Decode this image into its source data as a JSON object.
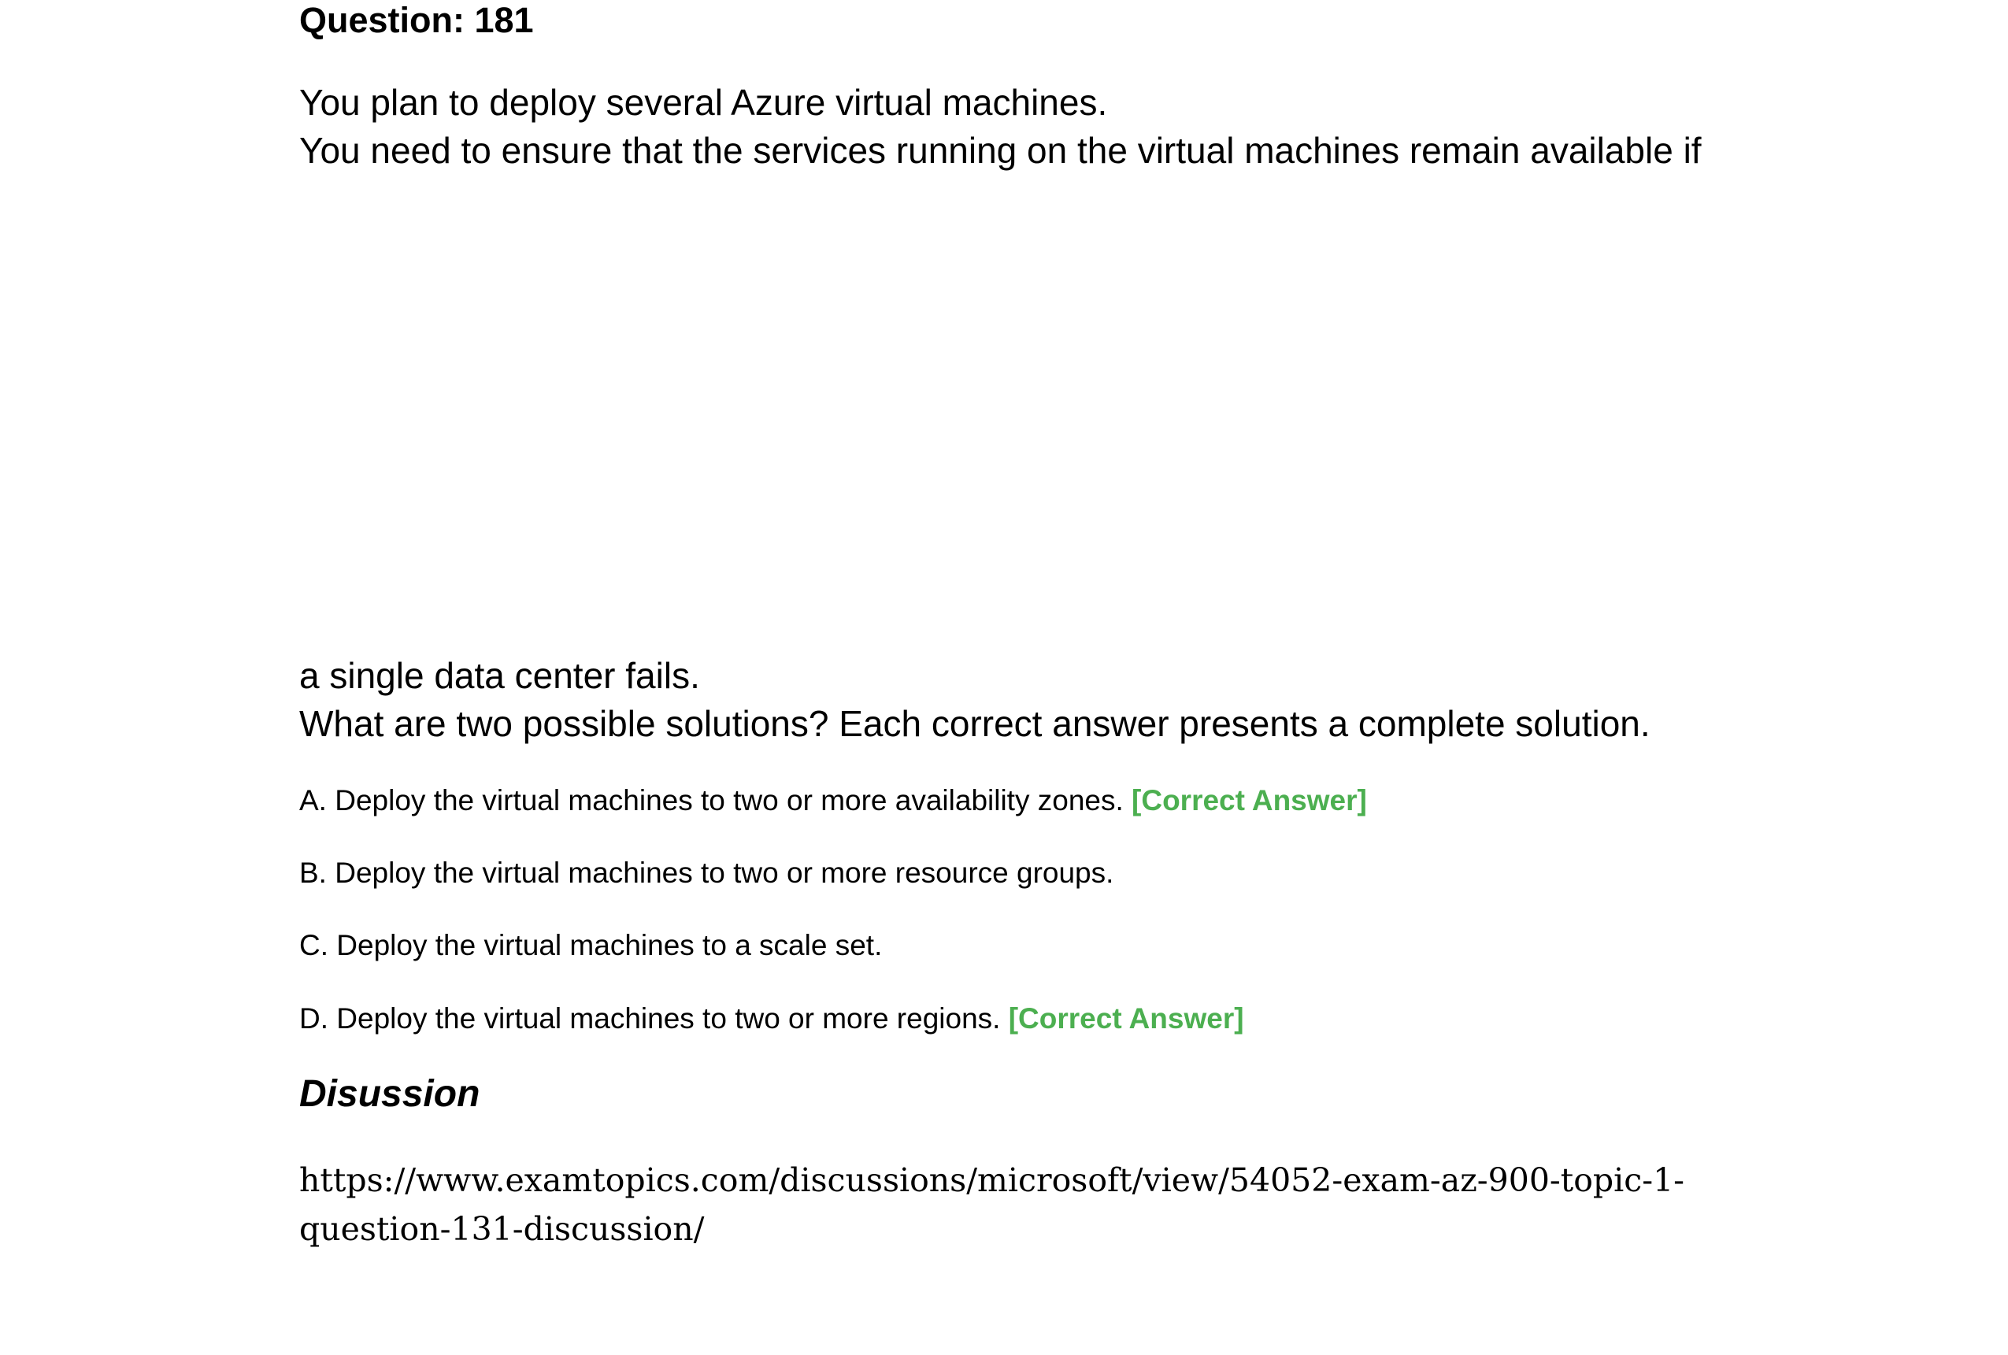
{
  "question": {
    "title": "Question: 181",
    "stem": [
      "You plan to deploy several Azure virtual machines.",
      "You need to ensure that the services running on the virtual machines remain available if",
      "a single data center fails.",
      "What are two possible solutions? Each correct answer presents a complete solution."
    ],
    "options": [
      {
        "text": "A. Deploy the virtual machines to two or more availability zones.",
        "tag": "[Correct Answer]"
      },
      {
        "text": "B. Deploy the virtual machines to two or more resource groups.",
        "tag": ""
      },
      {
        "text": "C. Deploy the virtual machines to a scale set.",
        "tag": ""
      },
      {
        "text": "D. Deploy the virtual machines to two or more regions.",
        "tag": "[Correct Answer]"
      }
    ]
  },
  "discussion": {
    "heading": "Disussion",
    "link": "https://www.examtopics.com/discussions/microsoft/view/54052-exam-az-900-topic-1-question-131-discussion/"
  },
  "colors": {
    "correct": "#4caf50",
    "text": "#000000"
  }
}
